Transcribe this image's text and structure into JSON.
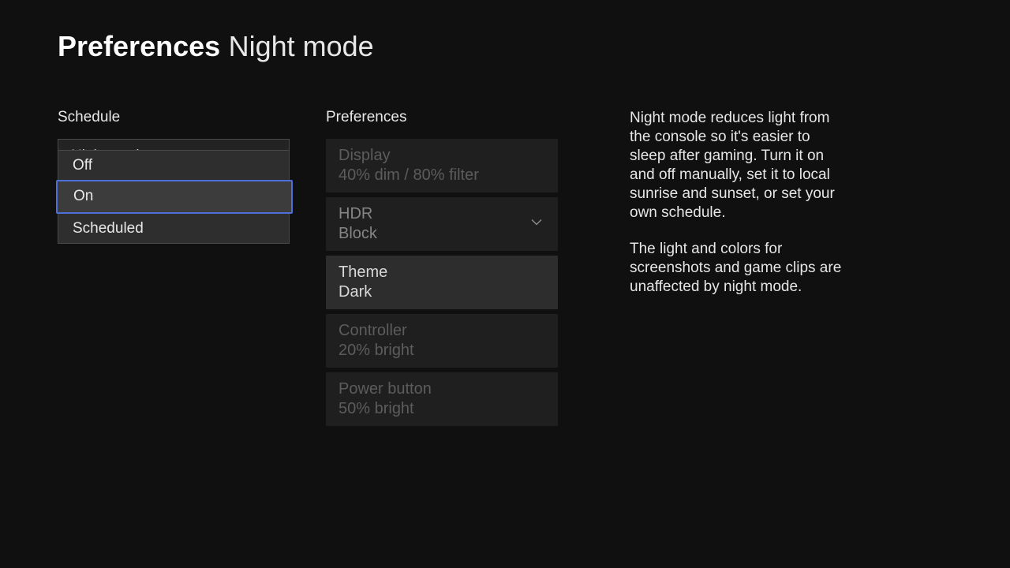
{
  "header": {
    "bold": "Preferences",
    "light": "Night mode"
  },
  "schedule": {
    "title": "Schedule",
    "behind_label": "Night mode",
    "options": [
      "Off",
      "On",
      "Scheduled"
    ],
    "selected_index": 1
  },
  "preferences": {
    "title": "Preferences",
    "items": [
      {
        "label": "Display",
        "value": "40% dim / 80% filter",
        "state": "disabled",
        "chevron": false
      },
      {
        "label": "HDR",
        "value": "Block",
        "state": "dim",
        "chevron": true
      },
      {
        "label": "Theme",
        "value": "Dark",
        "state": "active",
        "chevron": false
      },
      {
        "label": "Controller",
        "value": "20% bright",
        "state": "disabled",
        "chevron": false
      },
      {
        "label": "Power button",
        "value": "50% bright",
        "state": "disabled",
        "chevron": false
      }
    ]
  },
  "description": {
    "para1": "Night mode reduces light from the console so it's easier to sleep after gaming. Turn it on and off manually, set it to local sunrise and sunset, or set your own schedule.",
    "para2": "The light and colors for screenshots and game clips are unaffected by night mode."
  }
}
